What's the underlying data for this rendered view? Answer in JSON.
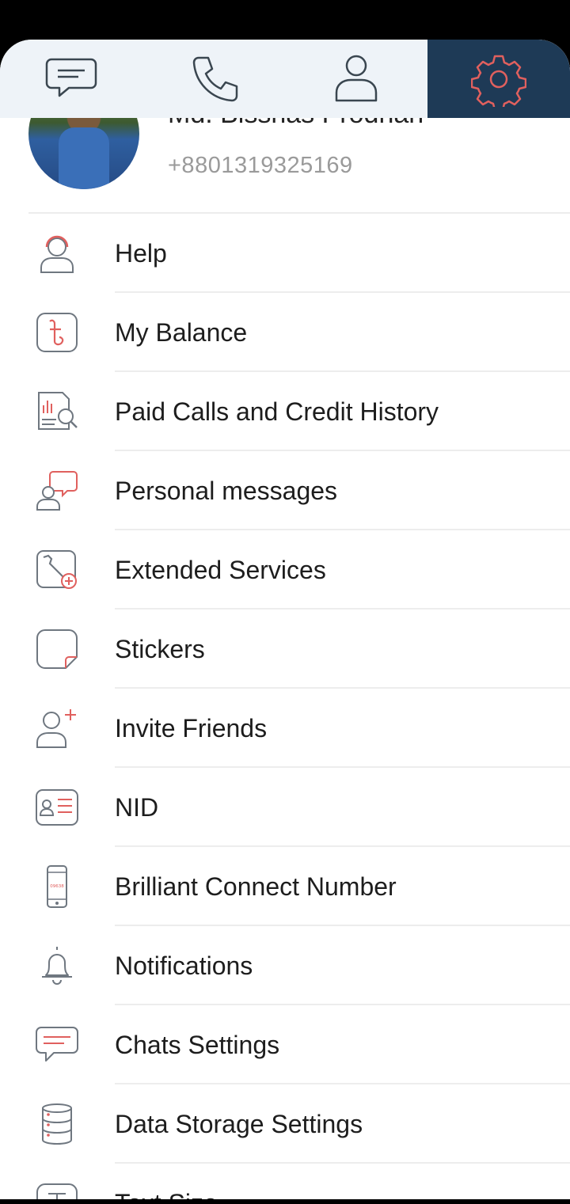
{
  "tabs": [
    {
      "name": "chats",
      "icon": "chat-bubble-icon"
    },
    {
      "name": "calls",
      "icon": "phone-icon"
    },
    {
      "name": "contacts",
      "icon": "person-icon"
    },
    {
      "name": "settings",
      "icon": "gear-icon",
      "active": true
    }
  ],
  "profile": {
    "name": "Md. Bisshas Prodhan",
    "phone": "+8801319325169"
  },
  "menu": [
    {
      "label": "Help",
      "icon": "support-agent-icon"
    },
    {
      "label": "My Balance",
      "icon": "taka-wallet-icon"
    },
    {
      "label": "Paid Calls and Credit History",
      "icon": "report-search-icon"
    },
    {
      "label": "Personal messages",
      "icon": "person-message-icon"
    },
    {
      "label": "Extended Services",
      "icon": "wrench-plus-icon"
    },
    {
      "label": "Stickers",
      "icon": "sticker-icon"
    },
    {
      "label": "Invite Friends",
      "icon": "add-person-icon"
    },
    {
      "label": "NID",
      "icon": "id-card-icon"
    },
    {
      "label": "Brilliant Connect Number",
      "icon": "mobile-phone-icon",
      "phone_screen_text": "09638"
    },
    {
      "label": "Notifications",
      "icon": "bell-icon"
    },
    {
      "label": "Chats Settings",
      "icon": "chat-settings-icon"
    },
    {
      "label": "Data Storage Settings",
      "icon": "database-icon"
    },
    {
      "label": "Text Size",
      "icon": "text-size-icon"
    }
  ],
  "colors": {
    "tab_active_bg": "#1e3a56",
    "tab_bar_bg": "#eef3f8",
    "accent": "#e0605e",
    "icon_gray": "#6f7780"
  }
}
